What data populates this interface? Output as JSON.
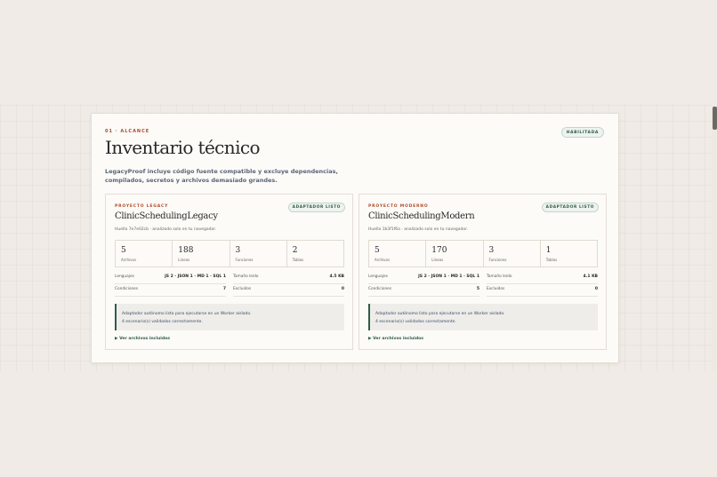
{
  "section": {
    "eyebrow": "01 · ALCANCE",
    "title": "Inventario técnico",
    "status": "HABILITADA",
    "description": "LegacyProof incluye código fuente compatible y excluye dependencias, compilados, secretos y archivos demasiado grandes."
  },
  "projects": [
    {
      "eyebrow": "PROYECTO LEGACY",
      "status": "ADAPTADOR LISTO",
      "name": "ClinicSchedulingLegacy",
      "fingerprint": "Huella 7e7e02cb · analizado solo en tu navegador.",
      "stats": [
        {
          "value": "5",
          "label": "Archivos"
        },
        {
          "value": "188",
          "label": "Líneas"
        },
        {
          "value": "3",
          "label": "Funciones"
        },
        {
          "value": "2",
          "label": "Tablas"
        }
      ],
      "languages_label": "Lenguajes",
      "languages": "JS 2 · JSON 1 · MD 1 · SQL 1",
      "size_label": "Tamaño leído",
      "size": "4.5 KB",
      "conditions_label": "Condiciones",
      "conditions": "7",
      "excluded_label": "Excluidos",
      "excluded": "0",
      "notice_1": "Adaptador autónomo listo para ejecutarse en un Worker aislado.",
      "notice_2": "4 escenario(s) validados correctamente.",
      "details": "▶ Ver archivos incluidos"
    },
    {
      "eyebrow": "PROYECTO MODERNO",
      "status": "ADAPTADOR LISTO",
      "name": "ClinicSchedulingModern",
      "fingerprint": "Huella 1b3f1f6a · analizado solo en tu navegador.",
      "stats": [
        {
          "value": "5",
          "label": "Archivos"
        },
        {
          "value": "170",
          "label": "Líneas"
        },
        {
          "value": "3",
          "label": "Funciones"
        },
        {
          "value": "1",
          "label": "Tablas"
        }
      ],
      "languages_label": "Lenguajes",
      "languages": "JS 2 · JSON 1 · MD 1 · SQL 1",
      "size_label": "Tamaño leído",
      "size": "4.1 KB",
      "conditions_label": "Condiciones",
      "conditions": "5",
      "excluded_label": "Excluidos",
      "excluded": "0",
      "notice_1": "Adaptador autónomo listo para ejecutarse en un Worker aislado.",
      "notice_2": "4 escenario(s) validados correctamente.",
      "details": "▶ Ver archivos incluidos"
    }
  ]
}
